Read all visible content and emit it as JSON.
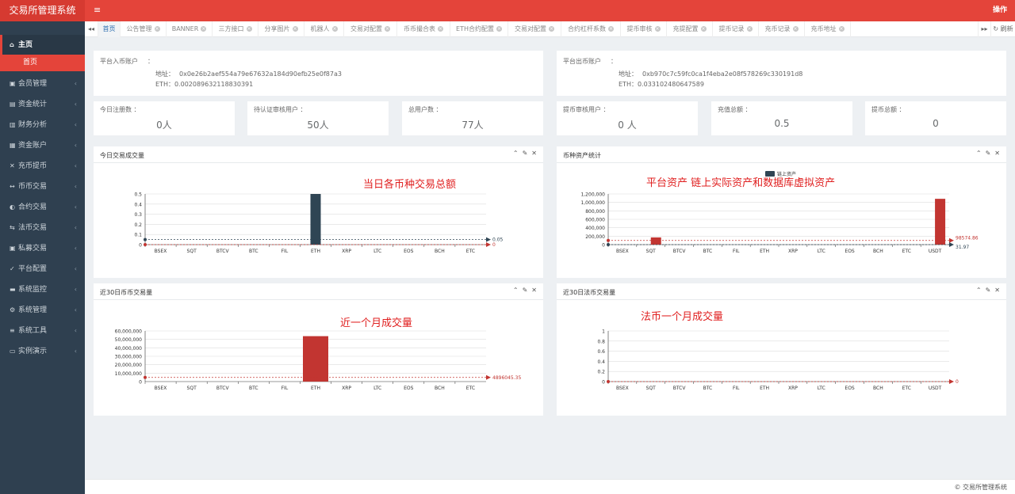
{
  "app": {
    "title": "交易所管理系统",
    "ops": "操作",
    "menu_glyph": "≡"
  },
  "sidebar": {
    "items": [
      {
        "icon": "home-icon",
        "glyph": "⌂",
        "label": "主页",
        "open": true
      },
      {
        "icon": "user-icon",
        "glyph": "▣",
        "label": "会员管理"
      },
      {
        "icon": "money-icon",
        "glyph": "▤",
        "label": "资金统计"
      },
      {
        "icon": "chart-icon",
        "glyph": "▥",
        "label": "财务分析"
      },
      {
        "icon": "account-icon",
        "glyph": "▦",
        "label": "资金账户"
      },
      {
        "icon": "exchange-icon",
        "glyph": "✕",
        "label": "充币提币"
      },
      {
        "icon": "swap-icon",
        "glyph": "↔",
        "label": "币币交易"
      },
      {
        "icon": "contract-icon",
        "glyph": "◐",
        "label": "合约交易"
      },
      {
        "icon": "fiat-icon",
        "glyph": "⇆",
        "label": "法币交易"
      },
      {
        "icon": "private-icon",
        "glyph": "▣",
        "label": "私募交易"
      },
      {
        "icon": "config-icon",
        "glyph": "✓",
        "label": "平台配置"
      },
      {
        "icon": "monitor-icon",
        "glyph": "▬",
        "label": "系统监控"
      },
      {
        "icon": "manage-icon",
        "glyph": "⚙",
        "label": "系统管理"
      },
      {
        "icon": "tool-icon",
        "glyph": "≡",
        "label": "系统工具"
      },
      {
        "icon": "demo-icon",
        "glyph": "▭",
        "label": "实例演示"
      }
    ],
    "sub_active": "首页",
    "chevron": "‹"
  },
  "tabs": {
    "left_nav": "◂◂",
    "right_nav": "▸▸",
    "refresh": "↻ 刷新",
    "items": [
      {
        "label": "首页",
        "active": true,
        "w": 28
      },
      {
        "label": "公告管理",
        "w": 58
      },
      {
        "label": "BANNER",
        "w": 58
      },
      {
        "label": "三方接口",
        "w": 58
      },
      {
        "label": "分享图片",
        "w": 58
      },
      {
        "label": "机器人",
        "w": 50
      },
      {
        "label": "交易对配置",
        "w": 67
      },
      {
        "label": "币币撮合表",
        "w": 67
      },
      {
        "label": "ETH合约配置",
        "w": 73
      },
      {
        "label": "交易对配置",
        "w": 67
      },
      {
        "label": "合约杠杆系数",
        "w": 75
      },
      {
        "label": "提币审核",
        "w": 58
      },
      {
        "label": "充提配置",
        "w": 58
      },
      {
        "label": "提币记录",
        "w": 58
      },
      {
        "label": "充币记录",
        "w": 58
      },
      {
        "label": "充币地址",
        "w": 58
      }
    ]
  },
  "accounts": {
    "in": {
      "label": "平台入币账户",
      "colon": "：",
      "addr_label": "地址：",
      "addr": "0x0e26b2aef554a79e67632a184d90efb25e0f87a3",
      "eth_label": "ETH：",
      "eth": "0.002089632118830391"
    },
    "out": {
      "label": "平台出币账户",
      "colon": "：",
      "addr_label": "地址：",
      "addr": "0xb970c7c59fc0ca1f4eba2e08f578269c330191d8",
      "eth_label": "ETH：",
      "eth": "0.033102480647589"
    }
  },
  "stats": [
    {
      "label": "今日注册数",
      "colon": "：",
      "value": "0人"
    },
    {
      "label": "待认证审核用户",
      "colon": "：",
      "value": "50人"
    },
    {
      "label": "总用户数",
      "colon": "：",
      "value": "77人"
    },
    {
      "label": "提币审核用户",
      "colon": "：",
      "value": "0 人"
    },
    {
      "label": "充值总额",
      "colon": "：",
      "value": "0.5"
    },
    {
      "label": "提币总额",
      "colon": "：",
      "value": "0"
    }
  ],
  "panels": {
    "tools": {
      "collapse": "⌃",
      "wrench": "✎",
      "close": "✕"
    },
    "daily": {
      "title": "今日交易成交量",
      "note": "当日各币种交易总额"
    },
    "assets": {
      "title": "币种资产统计",
      "note": "平台资产 链上实际资产和数据库虚拟资产",
      "legend": "链上资产"
    },
    "month_coin": {
      "title": "近30日币币交易量",
      "note": "近一个月成交量"
    },
    "month_fiat": {
      "title": "近30日法币交易量",
      "note": "法币一个月成交量"
    }
  },
  "colors": {
    "accent": "#e4443a",
    "sidebar": "#2f4050",
    "bar_dark": "#2f4554",
    "bar_red": "#c23531"
  },
  "chart_data": [
    {
      "type": "bar",
      "title": "今日交易成交量",
      "categories": [
        "BSEX",
        "SQT",
        "BTCV",
        "BTC",
        "FIL",
        "ETH",
        "XRP",
        "LTC",
        "EOS",
        "BCH",
        "ETC"
      ],
      "values": [
        0,
        0,
        0,
        0,
        0,
        0.5,
        0,
        0,
        0,
        0,
        0
      ],
      "yticks": [
        "0",
        "0.1",
        "0.2",
        "0.3",
        "0.4",
        "0.5"
      ],
      "ylim": [
        0,
        0.5
      ],
      "mark_lines": [
        {
          "value": 0.05,
          "label": "0.05",
          "color": "#2f4554"
        },
        {
          "value": 0,
          "label": "0",
          "color": "#c23531"
        }
      ],
      "color": "#2f4554"
    },
    {
      "type": "bar",
      "title": "币种资产统计",
      "categories": [
        "BSEX",
        "SQT",
        "BTCV",
        "BTC",
        "FIL",
        "ETH",
        "XRP",
        "LTC",
        "EOS",
        "BCH",
        "ETC",
        "USDT"
      ],
      "series": [
        {
          "name": "链上资产",
          "values": [
            0,
            0,
            0,
            0,
            0,
            0,
            0,
            0,
            0,
            0,
            0,
            0
          ],
          "color": "#2f4554"
        },
        {
          "values": [
            0,
            171000,
            0,
            0,
            0,
            0,
            0,
            0,
            0,
            0,
            0,
            1085000
          ],
          "color": "#c23531"
        }
      ],
      "yticks": [
        "0",
        "200,000",
        "400,000",
        "600,000",
        "800,000",
        "1,000,000",
        "1,200,000"
      ],
      "ylim": [
        0,
        1200000
      ],
      "mark_lines": [
        {
          "value": 98574.86,
          "label": "98574.86",
          "color": "#c23531"
        },
        {
          "value": 31.97,
          "label": "31.97",
          "color": "#2f4554"
        }
      ]
    },
    {
      "type": "bar",
      "title": "近30日币币交易量",
      "categories": [
        "BSEX",
        "SQT",
        "BTCV",
        "BTC",
        "FIL",
        "ETH",
        "XRP",
        "LTC",
        "EOS",
        "BCH",
        "ETC"
      ],
      "values": [
        0,
        0,
        0,
        0,
        0,
        53800000,
        0,
        0,
        0,
        0,
        0
      ],
      "yticks": [
        "0",
        "10,000,000",
        "20,000,000",
        "30,000,000",
        "40,000,000",
        "50,000,000",
        "60,000,000"
      ],
      "ylim": [
        0,
        60000000
      ],
      "mark_lines": [
        {
          "value": 4896045.35,
          "label": "4896045.35",
          "color": "#c23531"
        }
      ],
      "color": "#c23531"
    },
    {
      "type": "bar",
      "title": "近30日法币交易量",
      "categories": [
        "BSEX",
        "SQT",
        "BTCV",
        "BTC",
        "FIL",
        "ETH",
        "XRP",
        "LTC",
        "EOS",
        "BCH",
        "ETC",
        "USDT"
      ],
      "values": [
        0,
        0,
        0,
        0,
        0,
        0,
        0,
        0,
        0,
        0,
        0,
        0
      ],
      "yticks": [
        "0",
        "0.2",
        "0.4",
        "0.6",
        "0.8",
        "1"
      ],
      "ylim": [
        0,
        1
      ],
      "mark_lines": [
        {
          "value": 0,
          "label": "0",
          "color": "#c23531"
        }
      ],
      "color": "#c23531"
    }
  ],
  "footer": "© 交易所管理系统"
}
